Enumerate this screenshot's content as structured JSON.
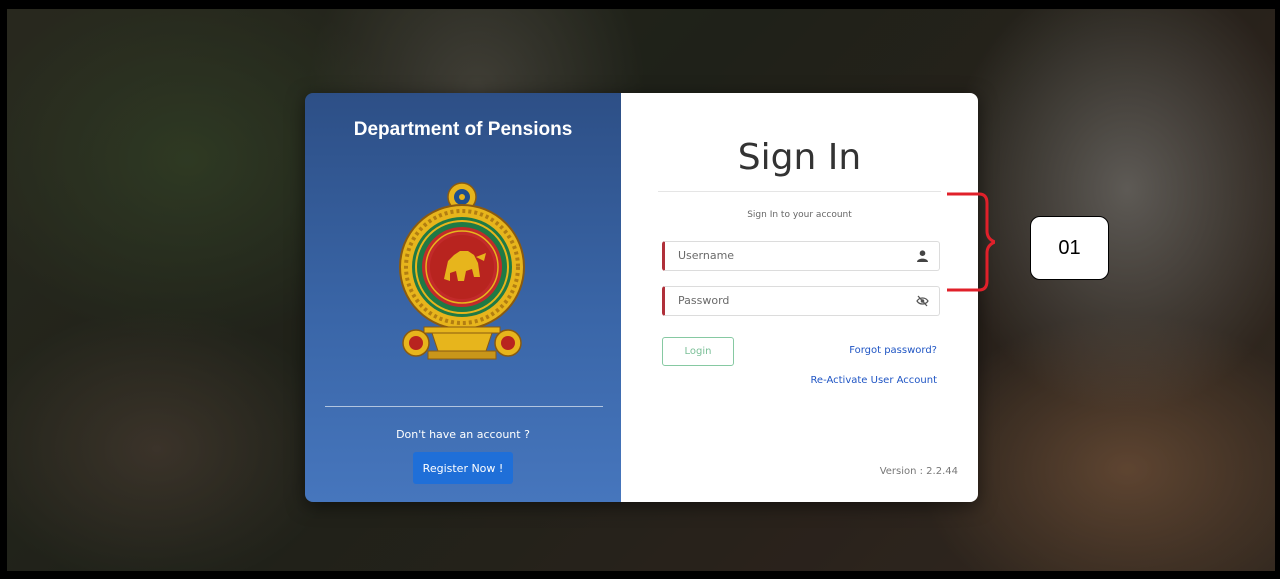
{
  "left_panel": {
    "title": "Department of Pensions",
    "emblem_icon": "sri-lanka-emblem-icon",
    "no_account_text": "Don't have an account ?",
    "register_label": "Register Now !"
  },
  "right_panel": {
    "title": "Sign In",
    "subtitle": "Sign In to your account",
    "username_placeholder": "Username",
    "username_icon": "user-icon",
    "password_placeholder": "Password",
    "password_icon": "eye-slash-icon",
    "login_label": "Login",
    "forgot_label": "Forgot password?",
    "reactivate_label": "Re-Activate User Account",
    "version_text": "Version : 2.2.44"
  },
  "annotation": {
    "label": "01",
    "color": "#e0202a"
  },
  "colors": {
    "left_panel": "#3a66a8",
    "register_button": "#1f6fd8",
    "field_accent": "#b0303a",
    "login_border": "#86c9a2",
    "link": "#1f55c4"
  }
}
